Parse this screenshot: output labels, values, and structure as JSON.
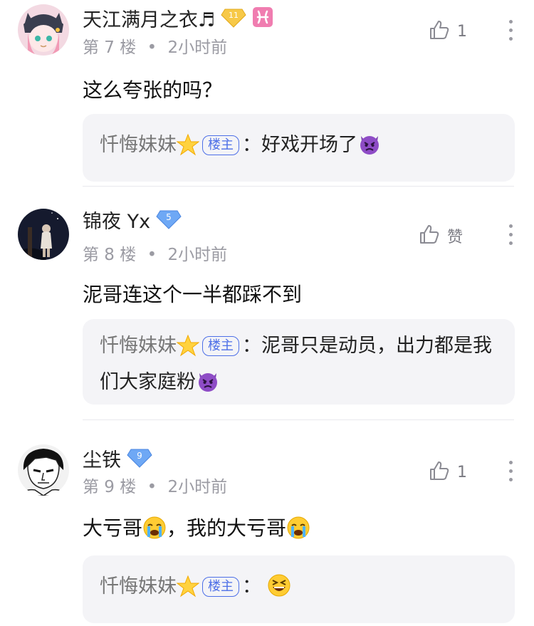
{
  "comments": [
    {
      "username": "天江满月之衣♬",
      "level": "11",
      "floor": "第 7 楼",
      "time": "2小时前",
      "likes": "1",
      "content": "这么夸张的吗？",
      "reply": {
        "author": "忏悔妹妹",
        "tag": "楼主",
        "separator": "：",
        "text": "好戏开场了"
      }
    },
    {
      "username": "锦夜 Yx",
      "level": "5",
      "floor": "第 8 楼",
      "time": "2小时前",
      "likes": "赞",
      "content": "泥哥连这个一半都踩不到",
      "reply": {
        "author": "忏悔妹妹",
        "tag": "楼主",
        "separator": "：",
        "text": "泥哥只是动员，出力都是我们大家庭粉"
      }
    },
    {
      "username": "尘铁",
      "level": "9",
      "floor": "第 9 楼",
      "time": "2小时前",
      "likes": "1",
      "content_parts": [
        "大亏哥",
        "，我的大亏哥"
      ],
      "reply": {
        "author": "忏悔妹妹",
        "tag": "楼主",
        "separator": "：",
        "text": ""
      }
    }
  ],
  "meta_separator": "•",
  "colors": {
    "host_tag": "#4d6fe7",
    "reply_bg": "#f4f4f7",
    "meta": "#9b9ba3",
    "divider": "#e9e9ee"
  }
}
